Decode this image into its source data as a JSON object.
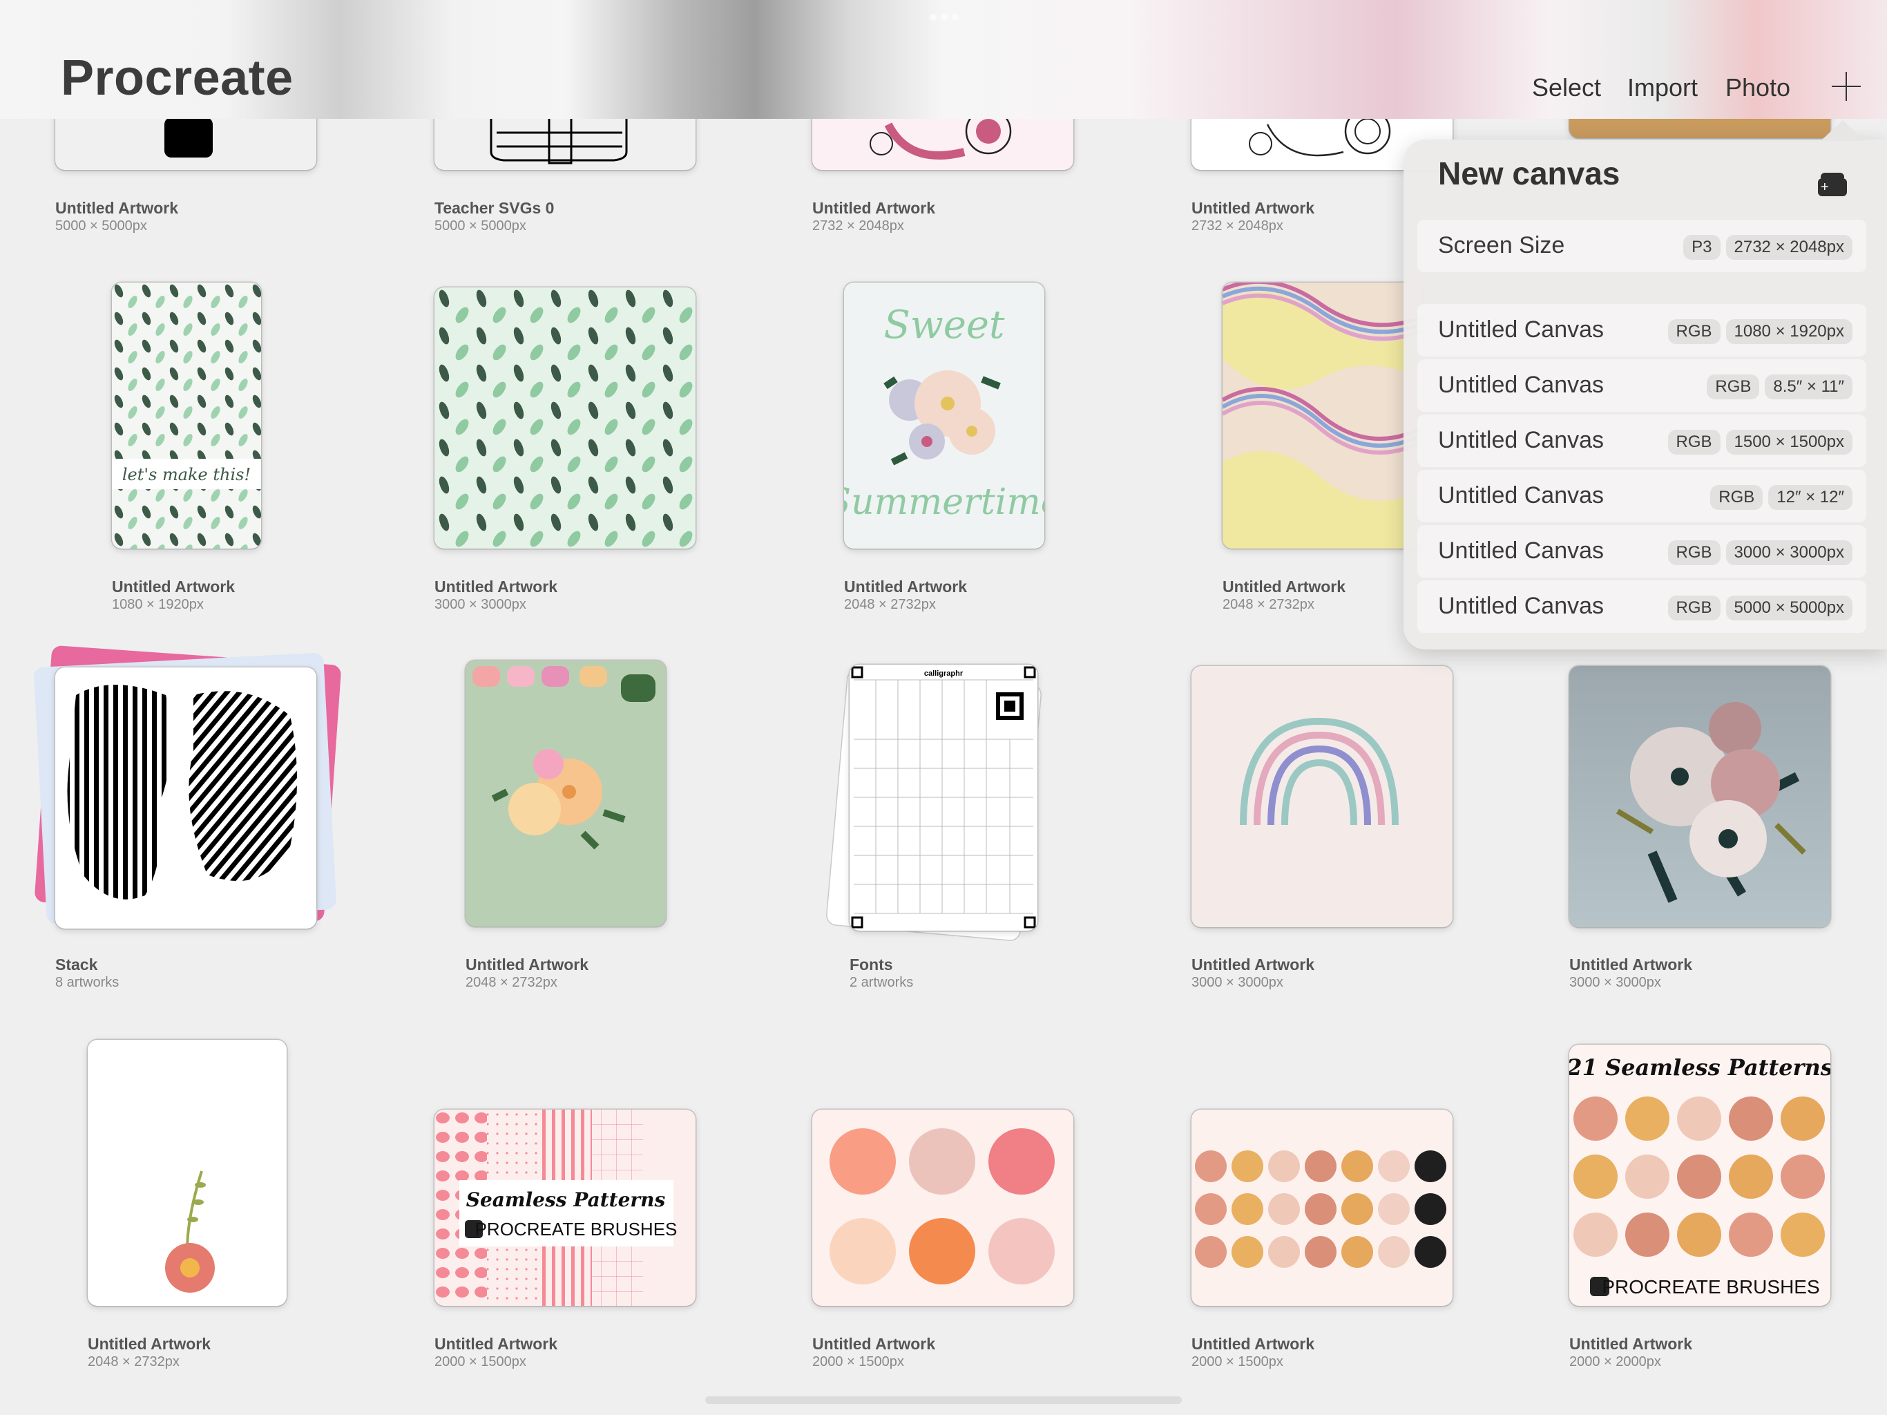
{
  "header": {
    "title": "Procreate",
    "actions": {
      "select": "Select",
      "import": "Import",
      "photo": "Photo"
    },
    "add_icon": "plus-icon"
  },
  "new_canvas": {
    "title": "New canvas",
    "new_preset_icon": "new-canvas-stack-icon",
    "screen_size": {
      "name": "Screen Size",
      "color": "P3",
      "size": "2732 × 2048px"
    },
    "presets": [
      {
        "name": "Untitled Canvas",
        "color": "RGB",
        "size": "1080 × 1920px"
      },
      {
        "name": "Untitled Canvas",
        "color": "RGB",
        "size": "8.5″ × 11″"
      },
      {
        "name": "Untitled Canvas",
        "color": "RGB",
        "size": "1500 × 1500px"
      },
      {
        "name": "Untitled Canvas",
        "color": "RGB",
        "size": "12″ × 12″"
      },
      {
        "name": "Untitled Canvas",
        "color": "RGB",
        "size": "3000 × 3000px"
      },
      {
        "name": "Untitled Canvas",
        "color": "RGB",
        "size": "5000 × 5000px"
      }
    ]
  },
  "gallery": {
    "row1": [
      {
        "title": "Untitled Artwork",
        "meta": "5000 × 5000px"
      },
      {
        "title": "Teacher SVGs 0",
        "meta": "5000 × 5000px"
      },
      {
        "title": "Untitled Artwork",
        "meta": "2732 × 2048px"
      },
      {
        "title": "Untitled Artwork",
        "meta": "2732 × 2048px"
      }
    ],
    "row2": [
      {
        "title": "Untitled Artwork",
        "meta": "1080 × 1920px",
        "thumb_text": "let's make this!"
      },
      {
        "title": "Untitled Artwork",
        "meta": "3000 × 3000px"
      },
      {
        "title": "Untitled Artwork",
        "meta": "2048 × 2732px",
        "thumb_text_top": "Sweet",
        "thumb_text_bottom": "Summertime"
      },
      {
        "title": "Untitled Artwork",
        "meta": "2048 × 2732px"
      }
    ],
    "row3": [
      {
        "title": "Stack",
        "meta": "8 artworks"
      },
      {
        "title": "Untitled Artwork",
        "meta": "2048 × 2732px"
      },
      {
        "title": "Fonts",
        "meta": "2 artworks",
        "thumb_text": "calligraphr"
      },
      {
        "title": "Untitled Artwork",
        "meta": "3000 × 3000px"
      },
      {
        "title": "Untitled Artwork",
        "meta": "3000 × 3000px"
      }
    ],
    "row4": [
      {
        "title": "Untitled Artwork",
        "meta": "2048 × 2732px"
      },
      {
        "title": "Untitled Artwork",
        "meta": "2000 × 1500px",
        "thumb_text_top": "Seamless Patterns",
        "thumb_text_bottom": "PROCREATE BRUSHES"
      },
      {
        "title": "Untitled Artwork",
        "meta": "2000 × 1500px"
      },
      {
        "title": "Untitled Artwork",
        "meta": "2000 × 1500px"
      },
      {
        "title": "Untitled Artwork",
        "meta": "2000 × 2000px",
        "thumb_text_top": "21 Seamless Patterns",
        "thumb_text_bottom": "PROCREATE BRUSHES"
      }
    ]
  },
  "colors": {
    "background": "#efefef",
    "text_primary": "#3c3c3c",
    "text_secondary": "#888888",
    "popover_bg": "#ecebea",
    "tag_bg": "#e3e1e0"
  }
}
